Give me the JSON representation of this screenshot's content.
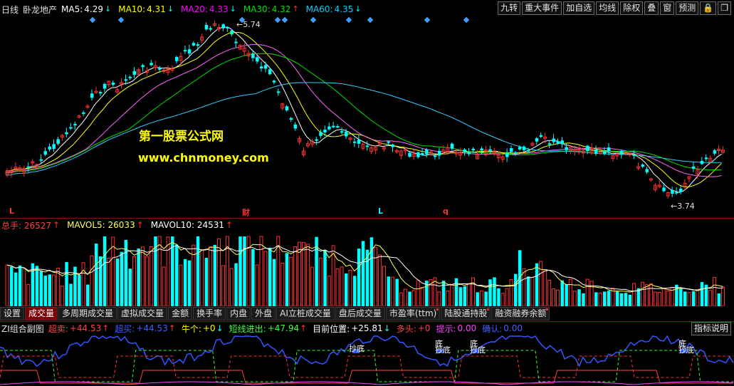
{
  "header": {
    "period": "日线",
    "stock": "卧龙地产",
    "ma": [
      {
        "label": "MA5:",
        "value": "4.29",
        "dir": "down",
        "color": "#ffffff"
      },
      {
        "label": "MA10:",
        "value": "4.31",
        "dir": "down",
        "color": "#ffff00"
      },
      {
        "label": "MA20:",
        "value": "4.33",
        "dir": "down",
        "color": "#ff00ff"
      },
      {
        "label": "MA30:",
        "value": "4.32",
        "dir": "up",
        "color": "#00e000"
      },
      {
        "label": "MA60:",
        "value": "4.35",
        "dir": "down",
        "color": "#00d0ff"
      }
    ],
    "buttons": [
      "九转",
      "重大事件",
      "加自选",
      "均线",
      "除权",
      "叠",
      "窗",
      "预测"
    ]
  },
  "price_panel": {
    "high_label": "5.74",
    "low_label": "3.74",
    "markers": [
      "L",
      "财",
      "L",
      "q"
    ],
    "watermark_cn": "第一股票公式网",
    "watermark_url": "www.chnmoney.com"
  },
  "volume_panel": {
    "items": [
      {
        "label": "总手: 26527",
        "color": "#ff4040"
      },
      {
        "label": "MAVOL5: 26033",
        "color": "#ffff60"
      },
      {
        "label": "MAVOL10: 24531",
        "color": "#ffffff"
      }
    ]
  },
  "tabs": [
    "设置",
    "成交量",
    "多周期成交量",
    "虚拟成交量",
    "金额",
    "换手率",
    "内盘",
    "外盘",
    "AI立桩成交量",
    "盘后成交量",
    "市盈率(ttm)",
    "陆股通持股",
    "融资融券余额"
  ],
  "indicator": {
    "name": "ZI组合副图",
    "items": [
      {
        "key": "超卖:",
        "value": "+44.53",
        "dir": "up",
        "kcolor": "#ff4040",
        "vcolor": "#ff4040"
      },
      {
        "key": "超买:",
        "value": "+44.53",
        "dir": "up",
        "kcolor": "#4060ff",
        "vcolor": "#4060ff"
      },
      {
        "key": "牛个:",
        "value": "+0",
        "dir": "down",
        "kcolor": "#ffff00",
        "vcolor": "#ffff00"
      },
      {
        "key": "短线进出:",
        "value": "+47.94",
        "dir": "up",
        "kcolor": "#40ff40",
        "vcolor": "#40ff40"
      },
      {
        "key": "目前位置:",
        "value": "+25.81",
        "dir": "down",
        "kcolor": "#ffffff",
        "vcolor": "#ffffff"
      },
      {
        "key": "多头:",
        "value": "+0",
        "dir": "",
        "kcolor": "#ff4040",
        "vcolor": "#ff4040"
      },
      {
        "key": "提示:",
        "value": "0.00",
        "dir": "",
        "kcolor": "#ff40ff",
        "vcolor": "#ff40ff"
      },
      {
        "key": "确认:",
        "value": "0.00",
        "dir": "",
        "kcolor": "#4060ff",
        "vcolor": "#4060ff"
      }
    ],
    "explain_button": "指标说明",
    "signals": [
      "抄底",
      "底",
      "抄底",
      "底",
      "抄底",
      "底",
      "抄底"
    ]
  },
  "colors": {
    "up": "#ff3030",
    "down": "#00ffff",
    "grid": "#7a1010"
  }
}
